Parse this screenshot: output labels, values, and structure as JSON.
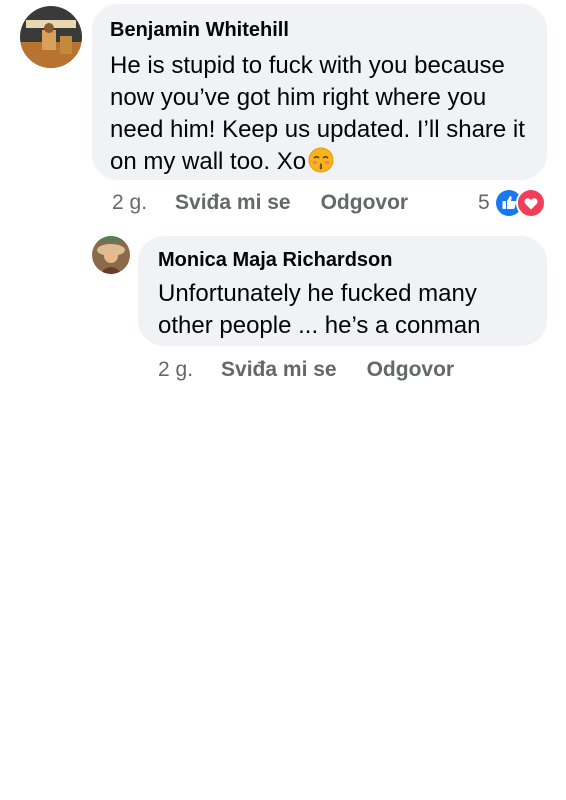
{
  "colors": {
    "bubble_bg": "#f0f2f5",
    "meta_text": "#65676b",
    "like_blue": "#1877f2",
    "love_red": "#f33e58"
  },
  "comment": {
    "author": "Benjamin Whitehill",
    "text": "He is stupid to fuck with you because now you’ve got him right where you need him! Keep us updated. I’ll share it on my wall too. Xo",
    "emoji": "kissing-face-emoji",
    "time": "2 g.",
    "like_label": "Sviđa mi se",
    "reply_label": "Odgovor",
    "reaction_count": "5",
    "reaction_icons": [
      "like-icon",
      "heart-icon"
    ]
  },
  "reply": {
    "author": "Monica Maja Richardson",
    "text": "Unfortunately he fucked many other people ... he’s a conman",
    "time": "2 g.",
    "like_label": "Sviđa mi se",
    "reply_label": "Odgovor"
  }
}
